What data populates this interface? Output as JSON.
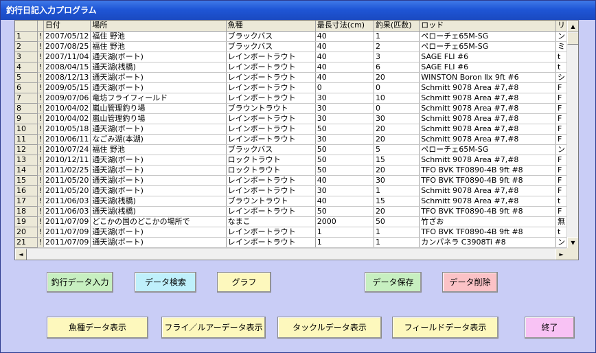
{
  "window": {
    "title": "釣行日記入力プログラム"
  },
  "grid": {
    "columns": [
      "",
      "",
      "日付",
      "場所",
      "魚種",
      "最長寸法(cm)",
      "釣果(匹数)",
      "ロッド",
      "リ"
    ],
    "rows": [
      [
        "1",
        "!",
        "2007/05/12",
        "福住 野池",
        "ブラックバス",
        "40",
        "1",
        "ペローチェ65M-SG",
        "ン"
      ],
      [
        "2",
        "!",
        "2007/08/25",
        "福住 野池",
        "ブラックバス",
        "40",
        "2",
        "ペローチェ65M-SG",
        "ミ"
      ],
      [
        "3",
        "!",
        "2007/11/04",
        "通天湖(ボート)",
        "レインボートラウト",
        "40",
        "3",
        "SAGE FLI #6",
        "t"
      ],
      [
        "4",
        "!",
        "2008/04/15",
        "通天湖(桟橋)",
        "レインボートラウト",
        "40",
        "6",
        "SAGE FLI #6",
        "t"
      ],
      [
        "5",
        "!",
        "2008/12/13",
        "通天湖(ボート)",
        "レインボートラウト",
        "40",
        "20",
        "WINSTON Boron Ⅱx 9ft #6",
        "シ"
      ],
      [
        "6",
        "!",
        "2009/05/15",
        "通天湖(ボート)",
        "レインボートラウト",
        "0",
        "0",
        "Schmitt 9078 Area #7,#8",
        "F"
      ],
      [
        "7",
        "!",
        "2009/07/06",
        "竜坊フライフィールド",
        "レインボートラウト",
        "30",
        "10",
        "Schmitt 9078 Area #7,#8",
        "F"
      ],
      [
        "8",
        "!",
        "2010/04/02",
        "嵐山管理釣り場",
        "ブラウントラウト",
        "30",
        "0",
        "Schmitt 9078 Area #7,#8",
        "F"
      ],
      [
        "9",
        "!",
        "2010/04/02",
        "嵐山管理釣り場",
        "レインボートラウト",
        "30",
        "30",
        "Schmitt 9078 Area #7,#8",
        "F"
      ],
      [
        "10",
        "!",
        "2010/05/18",
        "通天湖(ボート)",
        "レインボートラウト",
        "50",
        "20",
        "Schmitt 9078 Area #7,#8",
        "F"
      ],
      [
        "11",
        "!",
        "2010/06/11",
        "なごみ湖(本湖)",
        "レインボートラウト",
        "30",
        "20",
        "Schmitt 9078 Area #7,#8",
        "F"
      ],
      [
        "12",
        "!",
        "2010/07/24",
        "福住 野池",
        "ブラックバス",
        "50",
        "5",
        "ペローチェ65M-SG",
        "ン"
      ],
      [
        "13",
        "!",
        "2010/12/11",
        "通天湖(ボート)",
        "ロックトラウト",
        "50",
        "15",
        "Schmitt 9078 Area #7,#8",
        "F"
      ],
      [
        "14",
        "!",
        "2011/02/25",
        "通天湖(ボート)",
        "ロックトラウト",
        "50",
        "20",
        "TFO BVK TF0890-4B 9ft #8",
        "F"
      ],
      [
        "15",
        "!",
        "2011/05/20",
        "通天湖(ボート)",
        "レインボートラウト",
        "40",
        "30",
        "TFO BVK TF0890-4B 9ft #8",
        "F"
      ],
      [
        "16",
        "!",
        "2011/05/20",
        "通天湖(ボート)",
        "レインボートラウト",
        "30",
        "1",
        "Schmitt 9078 Area #7,#8",
        "F"
      ],
      [
        "17",
        "!",
        "2011/06/03",
        "通天湖(桟橋)",
        "ブラウントラウト",
        "40",
        "15",
        "Schmitt 9078 Area #7,#8",
        "t"
      ],
      [
        "18",
        "!",
        "2011/06/03",
        "通天湖(桟橋)",
        "レインボートラウト",
        "50",
        "20",
        "TFO BVK TF0890-4B 9ft #8",
        "F"
      ],
      [
        "19",
        "!",
        "2011/07/09",
        "どこかの国のどこかの場所で",
        "なまこ",
        "2000",
        "50",
        "竹ざお",
        "無"
      ],
      [
        "20",
        "!",
        "2011/07/09",
        "通天湖(ボート)",
        "レインボートラウト",
        "1",
        "1",
        "TFO BVK TF0890-4B 9ft #8",
        "t"
      ],
      [
        "21",
        "!",
        "2011/07/09",
        "通天湖(ボート)",
        "レインボートラウト",
        "1",
        "1",
        "カンパネラ C3908Ti #8",
        "ン"
      ]
    ]
  },
  "scroll": {
    "up": "▲",
    "down": "▼",
    "left": "◄",
    "right": "►"
  },
  "buttons": {
    "fishing_input": "釣行データ入力",
    "data_search": "データ検索",
    "graph": "グラフ",
    "data_save": "データ保存",
    "data_delete": "データ削除",
    "fish_data": "魚種データ表示",
    "fly_lure_data": "フライ／ルアーデータ表示",
    "tackle_data": "タックルデータ表示",
    "field_data": "フィールドデータ表示",
    "exit": "終了"
  },
  "colors": {
    "title_bar": "#1f56d6",
    "window_bg": "#c9cdf6",
    "btn_green": "#c7efc0",
    "btn_cyan": "#bff0fb",
    "btn_yellow": "#fdf8bd",
    "btn_pink": "#fbc2c6",
    "btn_magenta": "#f8c2f4"
  }
}
